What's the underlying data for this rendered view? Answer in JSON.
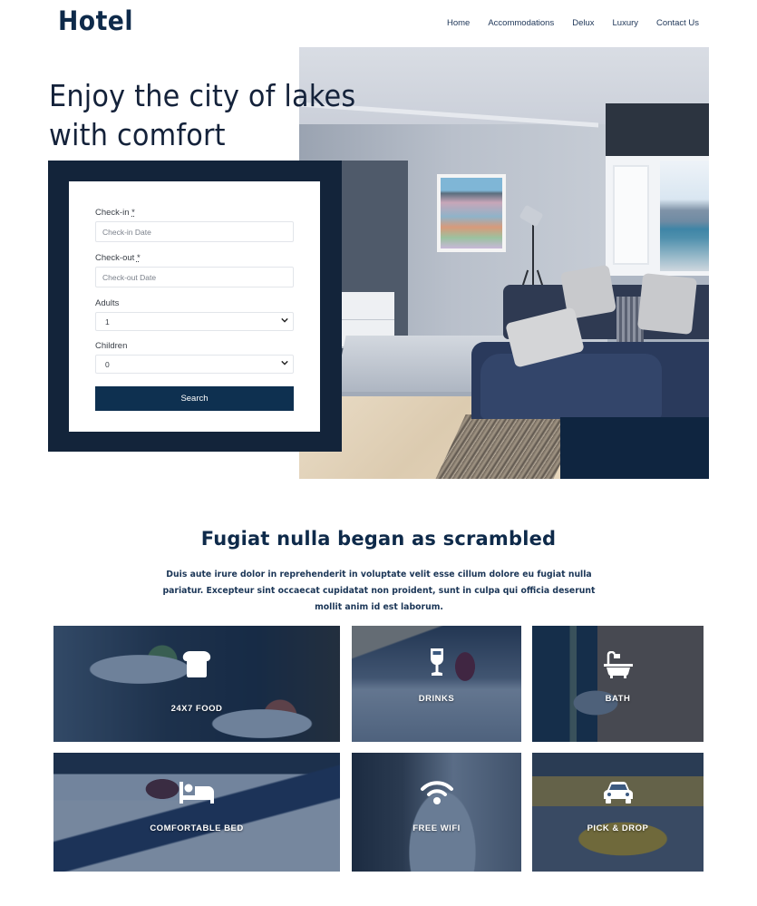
{
  "header": {
    "logo": "Hotel",
    "nav": [
      "Home",
      "Accommodations",
      "Delux",
      "Luxury",
      "Contact Us"
    ]
  },
  "hero": {
    "title_line1": "Enjoy the city of lakes",
    "title_line2": "with comfort",
    "image_alt": "living-room-photo"
  },
  "booking": {
    "checkin_label": "Check-in",
    "checkout_label": "Check-out",
    "required_mark": "*",
    "checkin_placeholder": "Check-in Date",
    "checkout_placeholder": "Check-out Date",
    "adults_label": "Adults",
    "adults_value": "1",
    "children_label": "Children",
    "children_value": "0",
    "search_label": "Search"
  },
  "intro": {
    "title": "Fugiat nulla began as scrambled",
    "text": "Duis aute irure dolor in reprehenderit in voluptate velit esse cillum dolore eu fugiat nulla pariatur. Excepteur sint occaecat cupidatat non proident, sunt in culpa qui officia deserunt mollit anim id est laborum."
  },
  "amenities": [
    {
      "label": "24X7 FOOD",
      "icon": "bread-icon"
    },
    {
      "label": "DRINKS",
      "icon": "wine-glass-icon"
    },
    {
      "label": "BATH",
      "icon": "bath-icon"
    },
    {
      "label": "COMFORTABLE BED",
      "icon": "bed-icon"
    },
    {
      "label": "FREE WIFI",
      "icon": "wifi-icon"
    },
    {
      "label": "PICK & DROP",
      "icon": "car-icon"
    }
  ],
  "colors": {
    "brand_navy": "#0e2a4a",
    "frame_navy": "#13243a",
    "button": "#0e3050",
    "tile_overlay": "#102e56"
  }
}
